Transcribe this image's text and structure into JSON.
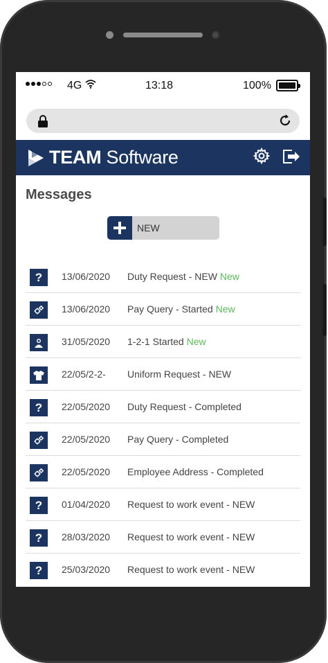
{
  "status_bar": {
    "carrier": "4G",
    "time": "13:18",
    "battery": "100%"
  },
  "app": {
    "brand_bold": "TEAM",
    "brand_light": " Software",
    "colors": {
      "primary": "#1b3560",
      "new_tag": "#5cb85c"
    }
  },
  "page": {
    "title": "Messages",
    "new_button_label": "NEW"
  },
  "messages": [
    {
      "icon": "question-icon",
      "date": "13/06/2020",
      "subject": "Duty Request - NEW",
      "tag": "New"
    },
    {
      "icon": "gears-icon",
      "date": "13/06/2020",
      "subject": "Pay Query - Started",
      "tag": "New"
    },
    {
      "icon": "people-icon",
      "date": "31/05/2020",
      "subject": "1-2-1 Started",
      "tag": "New"
    },
    {
      "icon": "shirt-icon",
      "date": "22/05/2-2-",
      "subject": "Uniform Request - NEW",
      "tag": ""
    },
    {
      "icon": "question-icon",
      "date": "22/05/2020",
      "subject": "Duty Request - Completed",
      "tag": ""
    },
    {
      "icon": "gears-icon",
      "date": "22/05/2020",
      "subject": "Pay Query - Completed",
      "tag": ""
    },
    {
      "icon": "gears-icon",
      "date": "22/05/2020",
      "subject": "Employee Address - Completed",
      "tag": ""
    },
    {
      "icon": "question-icon",
      "date": "01/04/2020",
      "subject": "Request to work event - NEW",
      "tag": ""
    },
    {
      "icon": "question-icon",
      "date": "28/03/2020",
      "subject": "Request to work event - NEW",
      "tag": ""
    },
    {
      "icon": "question-icon",
      "date": "25/03/2020",
      "subject": "Request to work event - NEW",
      "tag": ""
    }
  ]
}
